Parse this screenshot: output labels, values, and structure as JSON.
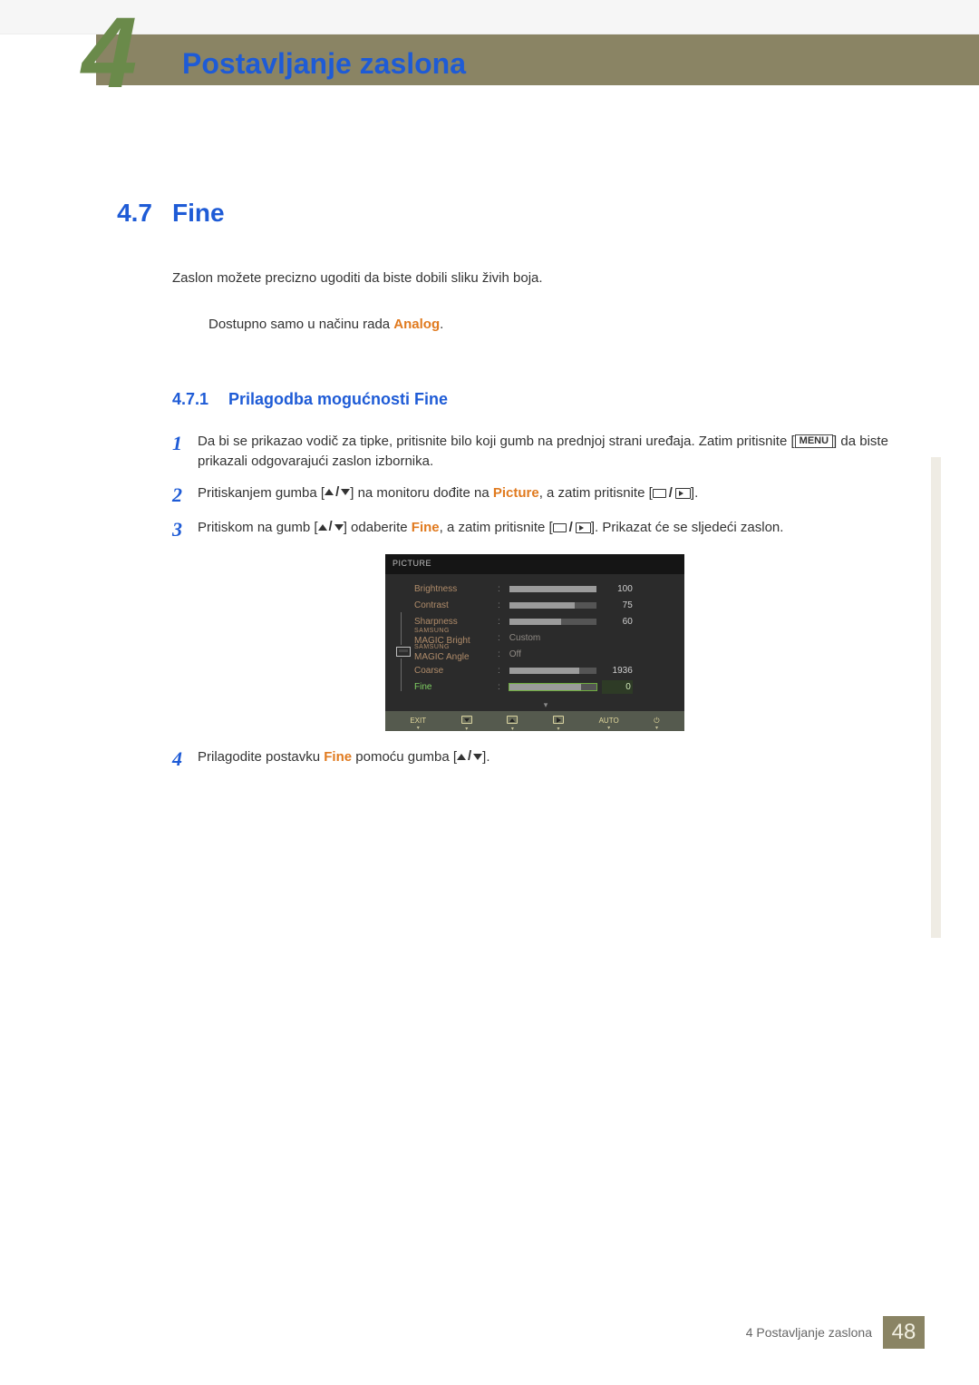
{
  "header": {
    "big_number": "4",
    "chapter_title": "Postavljanje zaslona"
  },
  "section": {
    "number": "4.7",
    "title": "Fine",
    "intro": "Zaslon možete precizno ugoditi da biste dobili sliku živih boja.",
    "note_prefix": "Dostupno samo u načinu rada ",
    "note_bold": "Analog",
    "note_suffix": "."
  },
  "subsection": {
    "number": "4.7.1",
    "title": "Prilagodba mogućnosti Fine"
  },
  "steps": {
    "s1": {
      "num": "1",
      "a": "Da bi se prikazao vodič za tipke, pritisnite bilo koji gumb na prednjoj strani uređaja. Zatim pritisnite [",
      "menu": "MENU",
      "b": "] da biste prikazali odgovarajući zaslon izbornika."
    },
    "s2": {
      "num": "2",
      "a": "Pritiskanjem gumba [",
      "b": "] na monitoru dođite na ",
      "picture": "Picture",
      "c": ", a zatim pritisnite [",
      "d": "]."
    },
    "s3": {
      "num": "3",
      "a": "Pritiskom na gumb [",
      "b": "] odaberite ",
      "fine": "Fine",
      "c": ", a zatim pritisnite [",
      "d": "]. Prikazat će se sljedeći zaslon."
    },
    "s4": {
      "num": "4",
      "a": "Prilagodite postavku ",
      "fine": "Fine",
      "b": " pomoću gumba [",
      "c": "]."
    }
  },
  "osd": {
    "title": "PICTURE",
    "rows": [
      {
        "label": "Brightness",
        "value": "100",
        "bar": 100
      },
      {
        "label": "Contrast",
        "value": "75",
        "bar": 75
      },
      {
        "label": "Sharpness",
        "value": "60",
        "bar": 60
      },
      {
        "label_top": "SAMSUNG",
        "label_bot": "MAGIC Bright",
        "text": "Custom"
      },
      {
        "label_top": "SAMSUNG",
        "label_bot": "MAGIC Angle",
        "text": "Off"
      },
      {
        "label": "Coarse",
        "value": "1936",
        "bar": 80
      },
      {
        "label": "Fine",
        "value": "0",
        "bar": 82,
        "selected": true
      }
    ],
    "footer": {
      "exit": "EXIT",
      "auto": "AUTO"
    }
  },
  "footer": {
    "text": "4 Postavljanje zaslona",
    "page": "48"
  }
}
